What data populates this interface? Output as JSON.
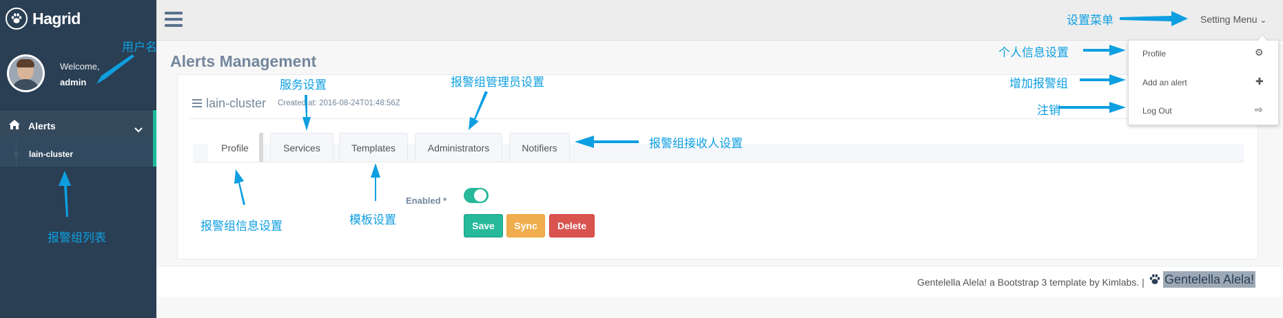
{
  "brand": {
    "name": "Hagrid",
    "icon": "paw-icon"
  },
  "profile": {
    "welcome": "Welcome,",
    "username": "admin"
  },
  "sidebar": {
    "items": [
      {
        "label": "Alerts",
        "icon": "home-icon",
        "chevron": "chevron-down-icon"
      }
    ],
    "sub_items": [
      {
        "label": "lain-cluster"
      }
    ]
  },
  "topnav": {
    "setting_menu": "Setting Menu",
    "setting_caret": "⌄"
  },
  "dropdown": {
    "items": [
      {
        "label": "Profile",
        "icon": "gear-icon",
        "glyph": "⚙"
      },
      {
        "label": "Add an alert",
        "icon": "plus-icon",
        "glyph": "✚"
      },
      {
        "label": "Log Out",
        "icon": "sign-out-icon",
        "glyph": "⇨"
      }
    ]
  },
  "page": {
    "title": "Alerts Management"
  },
  "panel": {
    "title": "lain-cluster",
    "created": "Created at: 2016-08-24T01:48:56Z",
    "tabs": [
      {
        "label": "Profile",
        "active": true
      },
      {
        "label": "Services"
      },
      {
        "label": "Templates"
      },
      {
        "label": "Administrators"
      },
      {
        "label": "Notifiers"
      }
    ],
    "form": {
      "enabled_label": "Enabled *",
      "enabled": true,
      "buttons": {
        "save": "Save",
        "sync": "Sync",
        "delete": "Delete"
      }
    }
  },
  "footer": {
    "text": "Gentelella Alela! a Bootstrap 3 template by Kimlabs. |",
    "brand": "Gentelella Alela!"
  },
  "annotations": {
    "username": "用户名",
    "alert_list": "报警组列表",
    "setting_menu": "设置菜单",
    "personal_settings": "个人信息设置",
    "add_alert_group": "增加报警组",
    "logout": "注销",
    "service_settings": "服务设置",
    "admin_settings": "报警组管理员设置",
    "receiver_settings": "报警组接收人设置",
    "group_info_settings": "报警组信息设置",
    "template_settings": "模板设置"
  },
  "colors": {
    "sidebar": "#2A3F54",
    "accent": "#1ABB9C",
    "save": "#26B99A",
    "sync": "#F0AD4E",
    "delete": "#D9534F",
    "annotation": "#0E9FE0"
  }
}
